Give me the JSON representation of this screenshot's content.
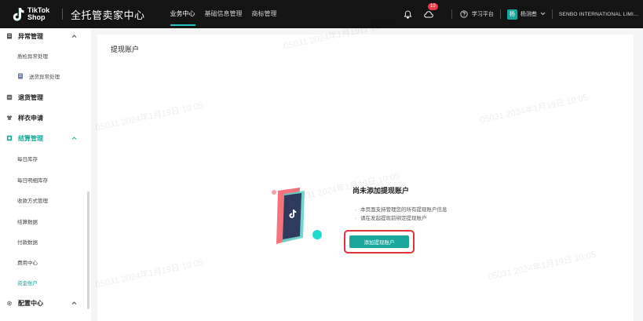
{
  "header": {
    "logo_text": "TikTok Shop",
    "app_title": "全托管卖家中心",
    "nav": [
      {
        "label": "业务中心",
        "active": true
      },
      {
        "label": "基础信息管理",
        "active": false
      },
      {
        "label": "商标管理",
        "active": false
      }
    ],
    "notification_count": "10",
    "help_label": "学习平台",
    "avatar_initial": "杨",
    "user_name": "杨测叁",
    "company": "SENBO INTERNATIONAL LIMI..."
  },
  "sidebar": {
    "groups": [
      {
        "label": "异常管理",
        "icon": "document-icon"
      },
      {
        "label": "退货管理",
        "icon": "return-icon"
      },
      {
        "label": "样衣申请",
        "icon": "shirt-icon"
      },
      {
        "label": "结算管理",
        "icon": "settlement-icon"
      },
      {
        "label": "配置中心",
        "icon": "gear-icon"
      }
    ],
    "items": [
      {
        "label": "质检异常处理"
      },
      {
        "label": "送货异常处理"
      },
      {
        "label": "每日库存"
      },
      {
        "label": "每日明细库存"
      },
      {
        "label": "收款方式管理"
      },
      {
        "label": "结算数据"
      },
      {
        "label": "付款数据"
      },
      {
        "label": "费用中心"
      },
      {
        "label": "资金账户"
      }
    ]
  },
  "main": {
    "title": "提现账户",
    "empty_title": "尚未添加提现账户",
    "empty_notes": [
      "本页面支持管理您的所有提现账户信息",
      "请在发起提现前绑定提现账户"
    ],
    "add_button_label": "添加提现账户"
  },
  "watermark": "05031 2024年1月19日 10:05",
  "colors": {
    "accent": "#1aa69a",
    "topbar": "#141414",
    "badge": "#e8394a",
    "highlight": "#e0353d"
  }
}
